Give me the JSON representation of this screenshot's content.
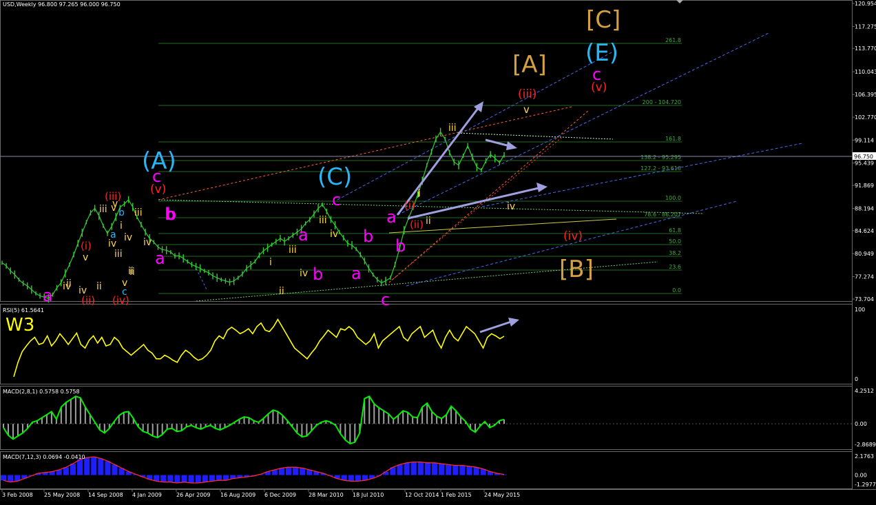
{
  "header": {
    "main": "USD,Weekly  96.800 97.265 96.000 96.750",
    "rsi": "RSI(5) 61.5641",
    "macd1": "MACD(2,8,1) 0.5758 0.5758",
    "macd2": "MACD(7,12,3) 0.0694 -0.0410"
  },
  "colors": {
    "bg": "#000000",
    "candle": "#33cc33",
    "grid": "#1f6e1f",
    "rsi": "#ffff00",
    "macd_line": "#00ee00",
    "macd_hist": "#a0a0a0",
    "macd2_line": "#ff2a2a",
    "macd2_hist": "#1e1eff",
    "wave_magenta": "#ff00ff",
    "wave_cyan": "#29b6f6",
    "wave_yellow": "#ffd54f",
    "wave_red": "#ff2222",
    "wave_orange": "#d4a040",
    "arrow": "#a0a0e0"
  },
  "price_axis": [
    "120.954",
    "117.275",
    "113.770",
    "110.043",
    "106.395",
    "102.770",
    "99.114",
    "95.439",
    "91.869",
    "88.194",
    "84.624",
    "80.949",
    "77.274",
    "73.704"
  ],
  "current_price": "96.750",
  "rsi_axis": [
    "100",
    "0"
  ],
  "macd1_axis": [
    "4.2512",
    "0.00",
    "-2.8689"
  ],
  "macd2_axis": [
    "2.1763",
    "0.00",
    "-1.2977"
  ],
  "time_axis": [
    "3 Feb 2008",
    "25 May 2008",
    "14 Sep 2008",
    "4 Jan 2009",
    "26 Apr 2009",
    "16 Aug 2009",
    "6 Dec 2009",
    "28 Mar 2010",
    "18 Jul 2010",
    "12 Oct 2014",
    "1 Feb 2015",
    "24 May 2015"
  ],
  "fib_levels": [
    "261.8",
    "200 - 104.720",
    "161.8",
    "138.2 - 95.295",
    "127.2 - 93.618",
    "100.0",
    "78.6 - 86.207",
    "61.8",
    "50.0",
    "38.2",
    "23.6",
    "0.0"
  ],
  "rsi_label": "W3",
  "wave_labels": [
    {
      "t": "[C]",
      "c": "wave_orange",
      "s": 34
    },
    {
      "t": "[A]",
      "c": "wave_orange",
      "s": 34
    },
    {
      "t": "(E)",
      "c": "wave_cyan",
      "s": 34
    },
    {
      "t": "c",
      "c": "wave_magenta",
      "s": 24
    },
    {
      "t": "(v)",
      "c": "wave_red",
      "s": 17
    },
    {
      "t": "(iii)",
      "c": "wave_red",
      "s": 17
    },
    {
      "t": "v",
      "c": "wave_yellow",
      "s": 15
    },
    {
      "t": "iii",
      "c": "wave_yellow",
      "s": 14
    },
    {
      "t": "(A)",
      "c": "wave_cyan",
      "s": 34
    },
    {
      "t": "c",
      "c": "wave_magenta",
      "s": 24
    },
    {
      "t": "(v)",
      "c": "wave_red",
      "s": 17
    },
    {
      "t": "(C)",
      "c": "wave_cyan",
      "s": 34
    },
    {
      "t": "c",
      "c": "wave_magenta",
      "s": 24
    },
    {
      "t": "a",
      "c": "wave_magenta",
      "s": 24
    },
    {
      "t": "(i)",
      "c": "wave_red",
      "s": 15
    },
    {
      "t": "i",
      "c": "wave_yellow",
      "s": 14
    },
    {
      "t": "iv",
      "c": "wave_yellow",
      "s": 14
    },
    {
      "t": "(ii)",
      "c": "wave_red",
      "s": 15
    },
    {
      "t": "ii",
      "c": "wave_yellow",
      "s": 14
    },
    {
      "t": "(iv)",
      "c": "wave_red",
      "s": 17
    },
    {
      "t": "[B]",
      "c": "wave_orange",
      "s": 34
    },
    {
      "t": "b",
      "c": "wave_magenta",
      "s": 24
    },
    {
      "t": "(iii)",
      "c": "wave_red",
      "s": 15
    },
    {
      "t": "iii",
      "c": "wave_yellow",
      "s": 14
    },
    {
      "t": "v",
      "c": "wave_yellow",
      "s": 14
    },
    {
      "t": "b",
      "c": "wave_cyan",
      "s": 14
    },
    {
      "t": "a",
      "c": "wave_cyan",
      "s": 14
    },
    {
      "t": "(i)",
      "c": "wave_red",
      "s": 15
    },
    {
      "t": "v",
      "c": "wave_yellow",
      "s": 14
    },
    {
      "t": "b",
      "c": "wave_magenta",
      "s": 24
    },
    {
      "t": "a",
      "c": "wave_magenta",
      "s": 24
    },
    {
      "t": "iii",
      "c": "wave_yellow",
      "s": 14
    },
    {
      "t": "a",
      "c": "wave_magenta",
      "s": 24
    },
    {
      "t": "b",
      "c": "wave_magenta",
      "s": 24
    },
    {
      "t": "a",
      "c": "wave_magenta",
      "s": 24
    },
    {
      "t": "b",
      "c": "wave_magenta",
      "s": 24
    },
    {
      "t": "c",
      "c": "wave_magenta",
      "s": 24
    },
    {
      "t": "iii",
      "c": "wave_yellow",
      "s": 14
    },
    {
      "t": "iv",
      "c": "wave_yellow",
      "s": 14
    },
    {
      "t": "i",
      "c": "wave_yellow",
      "s": 14
    },
    {
      "t": "ii",
      "c": "wave_yellow",
      "s": 14
    },
    {
      "t": "v",
      "c": "wave_yellow",
      "s": 14
    },
    {
      "t": "iii",
      "c": "wave_yellow",
      "s": 14
    },
    {
      "t": "iv",
      "c": "wave_yellow",
      "s": 14
    },
    {
      "t": "ii",
      "c": "wave_yellow",
      "s": 14
    },
    {
      "t": "i",
      "c": "wave_yellow",
      "s": 14
    },
    {
      "t": "iv",
      "c": "wave_yellow",
      "s": 14
    },
    {
      "t": "ii",
      "c": "wave_yellow",
      "s": 14
    },
    {
      "t": "a",
      "c": "wave_magenta",
      "s": 24
    },
    {
      "t": "iii",
      "c": "wave_yellow",
      "s": 14
    },
    {
      "t": "iv",
      "c": "wave_yellow",
      "s": 14
    },
    {
      "t": "(ii)",
      "c": "wave_red",
      "s": 15
    },
    {
      "t": "(iv)",
      "c": "wave_red",
      "s": 15
    },
    {
      "t": "c",
      "c": "wave_cyan",
      "s": 14
    },
    {
      "t": "v",
      "c": "wave_yellow",
      "s": 14
    },
    {
      "t": "iv",
      "c": "wave_yellow",
      "s": 14
    },
    {
      "t": "ii",
      "c": "wave_yellow",
      "s": 14
    },
    {
      "t": "i",
      "c": "wave_yellow",
      "s": 14
    },
    {
      "t": "b",
      "c": "wave_magenta",
      "s": 24
    },
    {
      "t": "iv",
      "c": "wave_yellow",
      "s": 14
    },
    {
      "t": "ii",
      "c": "wave_yellow",
      "s": 14
    },
    {
      "t": "iv",
      "c": "wave_yellow",
      "s": 14
    }
  ],
  "chart_data": {
    "type": "line",
    "title": "USD,Weekly",
    "ohlc_last": {
      "open": 96.8,
      "high": 97.265,
      "low": 96.0,
      "close": 96.75
    },
    "price_close": [
      79.5,
      79,
      78.2,
      77.6,
      76.8,
      76.2,
      75.8,
      75.2,
      74.6,
      74.2,
      74,
      73.8,
      74.4,
      75.5,
      76.3,
      77.8,
      79.2,
      80.8,
      82.6,
      84.3,
      86,
      87.5,
      88.2,
      87,
      85.4,
      84.2,
      85.3,
      86.8,
      88.4,
      88.9,
      89.6,
      88.4,
      86.8,
      85.6,
      84.4,
      83.4,
      82.8,
      82,
      81.6,
      81.5,
      81.2,
      80.6,
      80.6,
      80.2,
      79.7,
      79.2,
      78.9,
      78.6,
      78.2,
      77.9,
      77.4,
      77.1,
      76.8,
      76.6,
      76.4,
      76.6,
      77.1,
      77.7,
      78.6,
      79.1,
      79.7,
      80.7,
      81.4,
      81.9,
      82.4,
      82.9,
      83.4,
      82.9,
      83.4,
      83.9,
      84.4,
      84.9,
      85.8,
      86.4,
      87.3,
      88.2,
      88.8,
      87.7,
      86.4,
      85.5,
      84.4,
      83.5,
      82.6,
      82.3,
      81.7,
      80.8,
      79.8,
      78.6,
      77.6,
      76.8,
      76.3,
      76.6,
      77.1,
      79.2,
      81.8,
      84.7,
      86.7,
      88.4,
      90.4,
      92.6,
      95.1,
      97.2,
      99.3,
      100.4,
      99.3,
      97.1,
      95.6,
      95.1,
      96.6,
      98.2,
      96.4,
      94.8,
      94.3,
      95.8,
      96.8,
      96.2,
      95.5,
      96.75
    ],
    "rsi": [
      5,
      25,
      40,
      48,
      55,
      60,
      50,
      52,
      62,
      48,
      55,
      65,
      58,
      50,
      58,
      66,
      50,
      45,
      56,
      62,
      52,
      60,
      48,
      50,
      60,
      55,
      45,
      40,
      35,
      40,
      45,
      50,
      42,
      38,
      30,
      30,
      35,
      32,
      28,
      25,
      35,
      42,
      38,
      32,
      28,
      30,
      35,
      42,
      55,
      62,
      58,
      70,
      74,
      70,
      65,
      68,
      72,
      65,
      75,
      80,
      70,
      68,
      75,
      85,
      75,
      65,
      55,
      45,
      40,
      35,
      30,
      38,
      45,
      55,
      62,
      70,
      65,
      60,
      72,
      70,
      75,
      70,
      60,
      55,
      50,
      55,
      65,
      45,
      55,
      60,
      65,
      70,
      75,
      60,
      55,
      65,
      70,
      75,
      60,
      65,
      70,
      55,
      45,
      60,
      70,
      60,
      55,
      65,
      75,
      70,
      65,
      55,
      45,
      60,
      65,
      62,
      58,
      61.56
    ],
    "macd1": [
      -0.5,
      -1.5,
      -2,
      -1.6,
      -1.2,
      -0.6,
      0.2,
      0.4,
      0.8,
      1.2,
      1.6,
      0.6,
      2.2,
      2.8,
      3.2,
      3.6,
      3.4,
      2.2,
      1.2,
      0.2,
      -0.8,
      -1.2,
      -0.6,
      0.3,
      1.1,
      1.5,
      1.6,
      0.7,
      -0.4,
      -1,
      -1.2,
      -1.6,
      -1.8,
      -1.4,
      -0.7,
      -0.6,
      -1,
      -0.9,
      -0.4,
      -0.2,
      -0.5,
      -0.7,
      -0.4,
      -0.2,
      -0.6,
      -0.8,
      -0.5,
      -0.2,
      0.2,
      0.6,
      0.9,
      0.8,
      0.4,
      0.2,
      0.7,
      1.3,
      1.8,
      1.6,
      1.1,
      0.4,
      -0.4,
      -1.2,
      -1.7,
      -1.6,
      -0.9,
      -0.2,
      0.2,
      0.4,
      0.2,
      -0.2,
      -1.3,
      -2.1,
      -2.6,
      -2.4,
      -1.2,
      3.3,
      3.6,
      2.6,
      2.1,
      1.7,
      1.3,
      0.6,
      1.1,
      1.7,
      1.5,
      0.9,
      0.8,
      2.2,
      2.7,
      1.6,
      1.0,
      0.7,
      1.2,
      2.3,
      1.7,
      0.9,
      0.3,
      -0.7,
      -1.1,
      -0.3,
      0.3,
      -0.5,
      -0.2,
      0.4,
      0.5758
    ],
    "macd2": [
      -0.6,
      -0.8,
      -0.7,
      -0.4,
      -0.1,
      0.2,
      0.3,
      0.4,
      0.6,
      0.9,
      1.3,
      1.8,
      2.0,
      2.1,
      1.9,
      1.6,
      1.2,
      0.8,
      0.4,
      0.1,
      -0.2,
      -0.5,
      -0.7,
      -0.8,
      -0.8,
      -0.9,
      -0.8,
      -0.9,
      -0.9,
      -0.8,
      -0.7,
      -0.6,
      -0.6,
      -0.4,
      -0.3,
      -0.2,
      -0.1,
      0.1,
      0.4,
      0.6,
      0.8,
      0.9,
      0.9,
      0.8,
      0.6,
      0.4,
      0.2,
      -0.1,
      -0.4,
      -0.6,
      -0.7,
      -0.7,
      -0.6,
      -0.4,
      -0.1,
      0.4,
      0.9,
      1.2,
      1.4,
      1.5,
      1.5,
      1.4,
      1.4,
      1.3,
      1.2,
      1.1,
      1.1,
      1.0,
      0.9,
      0.7,
      0.4,
      0.2,
      0.0694
    ],
    "ylim_price": [
      73.704,
      120.954
    ],
    "ylim_rsi": [
      0,
      100
    ],
    "ylim_macd1": [
      -2.8689,
      4.2512
    ],
    "ylim_macd2": [
      -1.2977,
      2.1763
    ]
  }
}
